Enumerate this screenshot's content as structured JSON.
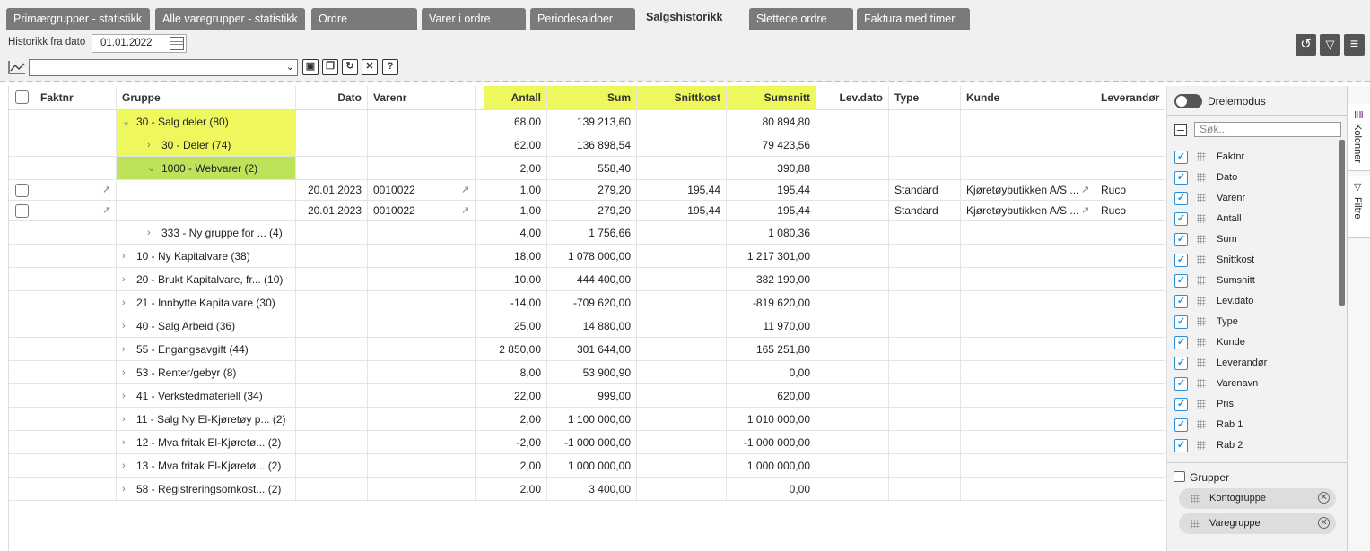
{
  "tabs": [
    {
      "label": "Primærgrupper - statistikk",
      "active": false
    },
    {
      "label": "Alle varegrupper - statistikk",
      "active": false
    },
    {
      "label": "Ordre",
      "active": false
    },
    {
      "label": "Varer i ordre",
      "active": false
    },
    {
      "label": "Periodesaldoer",
      "active": false
    },
    {
      "label": "Salgshistorikk",
      "active": true
    },
    {
      "label": "Slettede ordre",
      "active": false
    },
    {
      "label": "Faktura med timer",
      "active": false
    }
  ],
  "history": {
    "label": "Historikk fra dato",
    "date": "01.01.2022"
  },
  "toolbar_icons": [
    "reset-icon",
    "filter-icon",
    "menu-icon"
  ],
  "view_buttons": [
    "save-icon",
    "copy-icon",
    "refresh-icon",
    "delete-icon",
    "help-icon"
  ],
  "columns": {
    "faktnr": "Faktnr",
    "gruppe": "Gruppe",
    "dato": "Dato",
    "varenr": "Varenr",
    "antall": "Antall",
    "sum": "Sum",
    "snittkost": "Snittkost",
    "sumsnitt": "Sumsnitt",
    "levdato": "Lev.dato",
    "type": "Type",
    "kunde": "Kunde",
    "leverandor": "Leverandør"
  },
  "highlight_color": "#eef85c",
  "rows": [
    {
      "kind": "group",
      "level": 0,
      "expanded": true,
      "highlight": "yellow",
      "gruppe": "30 - Salg deler (80)",
      "antall": "68,00",
      "sum": "139 213,60",
      "snittkost": "",
      "sumsnitt": "80 894,80"
    },
    {
      "kind": "group",
      "level": 1,
      "expanded": false,
      "highlight": "yellow",
      "gruppe": "30 - Deler (74)",
      "antall": "62,00",
      "sum": "136 898,54",
      "snittkost": "",
      "sumsnitt": "79 423,56"
    },
    {
      "kind": "group",
      "level": 1,
      "expanded": true,
      "highlight": "green",
      "gruppe": "1000 - Webvarer (2)",
      "antall": "2,00",
      "sum": "558,40",
      "snittkost": "",
      "sumsnitt": "390,88"
    },
    {
      "kind": "leaf",
      "dato": "20.01.2023",
      "varenr": "0010022",
      "antall": "1,00",
      "sum": "279,20",
      "snittkost": "195,44",
      "sumsnitt": "195,44",
      "type": "Standard",
      "kunde": "Kjøretøybutikken A/S ...",
      "leverandor": "Ruco"
    },
    {
      "kind": "leaf",
      "dato": "20.01.2023",
      "varenr": "0010022",
      "antall": "1,00",
      "sum": "279,20",
      "snittkost": "195,44",
      "sumsnitt": "195,44",
      "type": "Standard",
      "kunde": "Kjøretøybutikken A/S ...",
      "leverandor": "Ruco"
    },
    {
      "kind": "group",
      "level": 1,
      "expanded": false,
      "highlight": "",
      "gruppe": "333 - Ny gruppe for ... (4)",
      "antall": "4,00",
      "sum": "1 756,66",
      "snittkost": "",
      "sumsnitt": "1 080,36"
    },
    {
      "kind": "group",
      "level": 0,
      "expanded": false,
      "highlight": "",
      "gruppe": "10 - Ny Kapitalvare (38)",
      "antall": "18,00",
      "sum": "1 078 000,00",
      "snittkost": "",
      "sumsnitt": "1 217 301,00"
    },
    {
      "kind": "group",
      "level": 0,
      "expanded": false,
      "highlight": "",
      "gruppe": "20 - Brukt Kapitalvare, fr... (10)",
      "antall": "10,00",
      "sum": "444 400,00",
      "snittkost": "",
      "sumsnitt": "382 190,00"
    },
    {
      "kind": "group",
      "level": 0,
      "expanded": false,
      "highlight": "",
      "gruppe": "21 - Innbytte Kapitalvare (30)",
      "antall": "-14,00",
      "sum": "-709 620,00",
      "snittkost": "",
      "sumsnitt": "-819 620,00"
    },
    {
      "kind": "group",
      "level": 0,
      "expanded": false,
      "highlight": "",
      "gruppe": "40 - Salg Arbeid (36)",
      "antall": "25,00",
      "sum": "14 880,00",
      "snittkost": "",
      "sumsnitt": "11 970,00"
    },
    {
      "kind": "group",
      "level": 0,
      "expanded": false,
      "highlight": "",
      "gruppe": "55 - Engangsavgift (44)",
      "antall": "2 850,00",
      "sum": "301 644,00",
      "snittkost": "",
      "sumsnitt": "165 251,80"
    },
    {
      "kind": "group",
      "level": 0,
      "expanded": false,
      "highlight": "",
      "gruppe": "53 - Renter/gebyr (8)",
      "antall": "8,00",
      "sum": "53 900,90",
      "snittkost": "",
      "sumsnitt": "0,00"
    },
    {
      "kind": "group",
      "level": 0,
      "expanded": false,
      "highlight": "",
      "gruppe": "41 - Verkstedmateriell (34)",
      "antall": "22,00",
      "sum": "999,00",
      "snittkost": "",
      "sumsnitt": "620,00"
    },
    {
      "kind": "group",
      "level": 0,
      "expanded": false,
      "highlight": "",
      "gruppe": "11 - Salg Ny El-Kjøretøy p... (2)",
      "antall": "2,00",
      "sum": "1 100 000,00",
      "snittkost": "",
      "sumsnitt": "1 010 000,00"
    },
    {
      "kind": "group",
      "level": 0,
      "expanded": false,
      "highlight": "",
      "gruppe": "12 - Mva fritak El-Kjøretø... (2)",
      "antall": "-2,00",
      "sum": "-1 000 000,00",
      "snittkost": "",
      "sumsnitt": "-1 000 000,00"
    },
    {
      "kind": "group",
      "level": 0,
      "expanded": false,
      "highlight": "",
      "gruppe": "13 - Mva fritak El-Kjøretø... (2)",
      "antall": "2,00",
      "sum": "1 000 000,00",
      "snittkost": "",
      "sumsnitt": "1 000 000,00"
    },
    {
      "kind": "group",
      "level": 0,
      "expanded": false,
      "highlight": "",
      "gruppe": "58 - Registreringsomkost... (2)",
      "antall": "2,00",
      "sum": "3 400,00",
      "snittkost": "",
      "sumsnitt": "0,00"
    }
  ],
  "side_panel": {
    "pivot_label": "Dreiemodus",
    "search_placeholder": "Søk...",
    "columns": [
      "Faktnr",
      "Dato",
      "Varenr",
      "Antall",
      "Sum",
      "Snittkost",
      "Sumsnitt",
      "Lev.dato",
      "Type",
      "Kunde",
      "Leverandør",
      "Varenavn",
      "Pris",
      "Rab 1",
      "Rab 2"
    ],
    "groups_label": "Grupper",
    "groups": [
      "Kontogruppe",
      "Varegruppe"
    ]
  },
  "side_tabs": [
    "Kolonner",
    "Filtre"
  ]
}
